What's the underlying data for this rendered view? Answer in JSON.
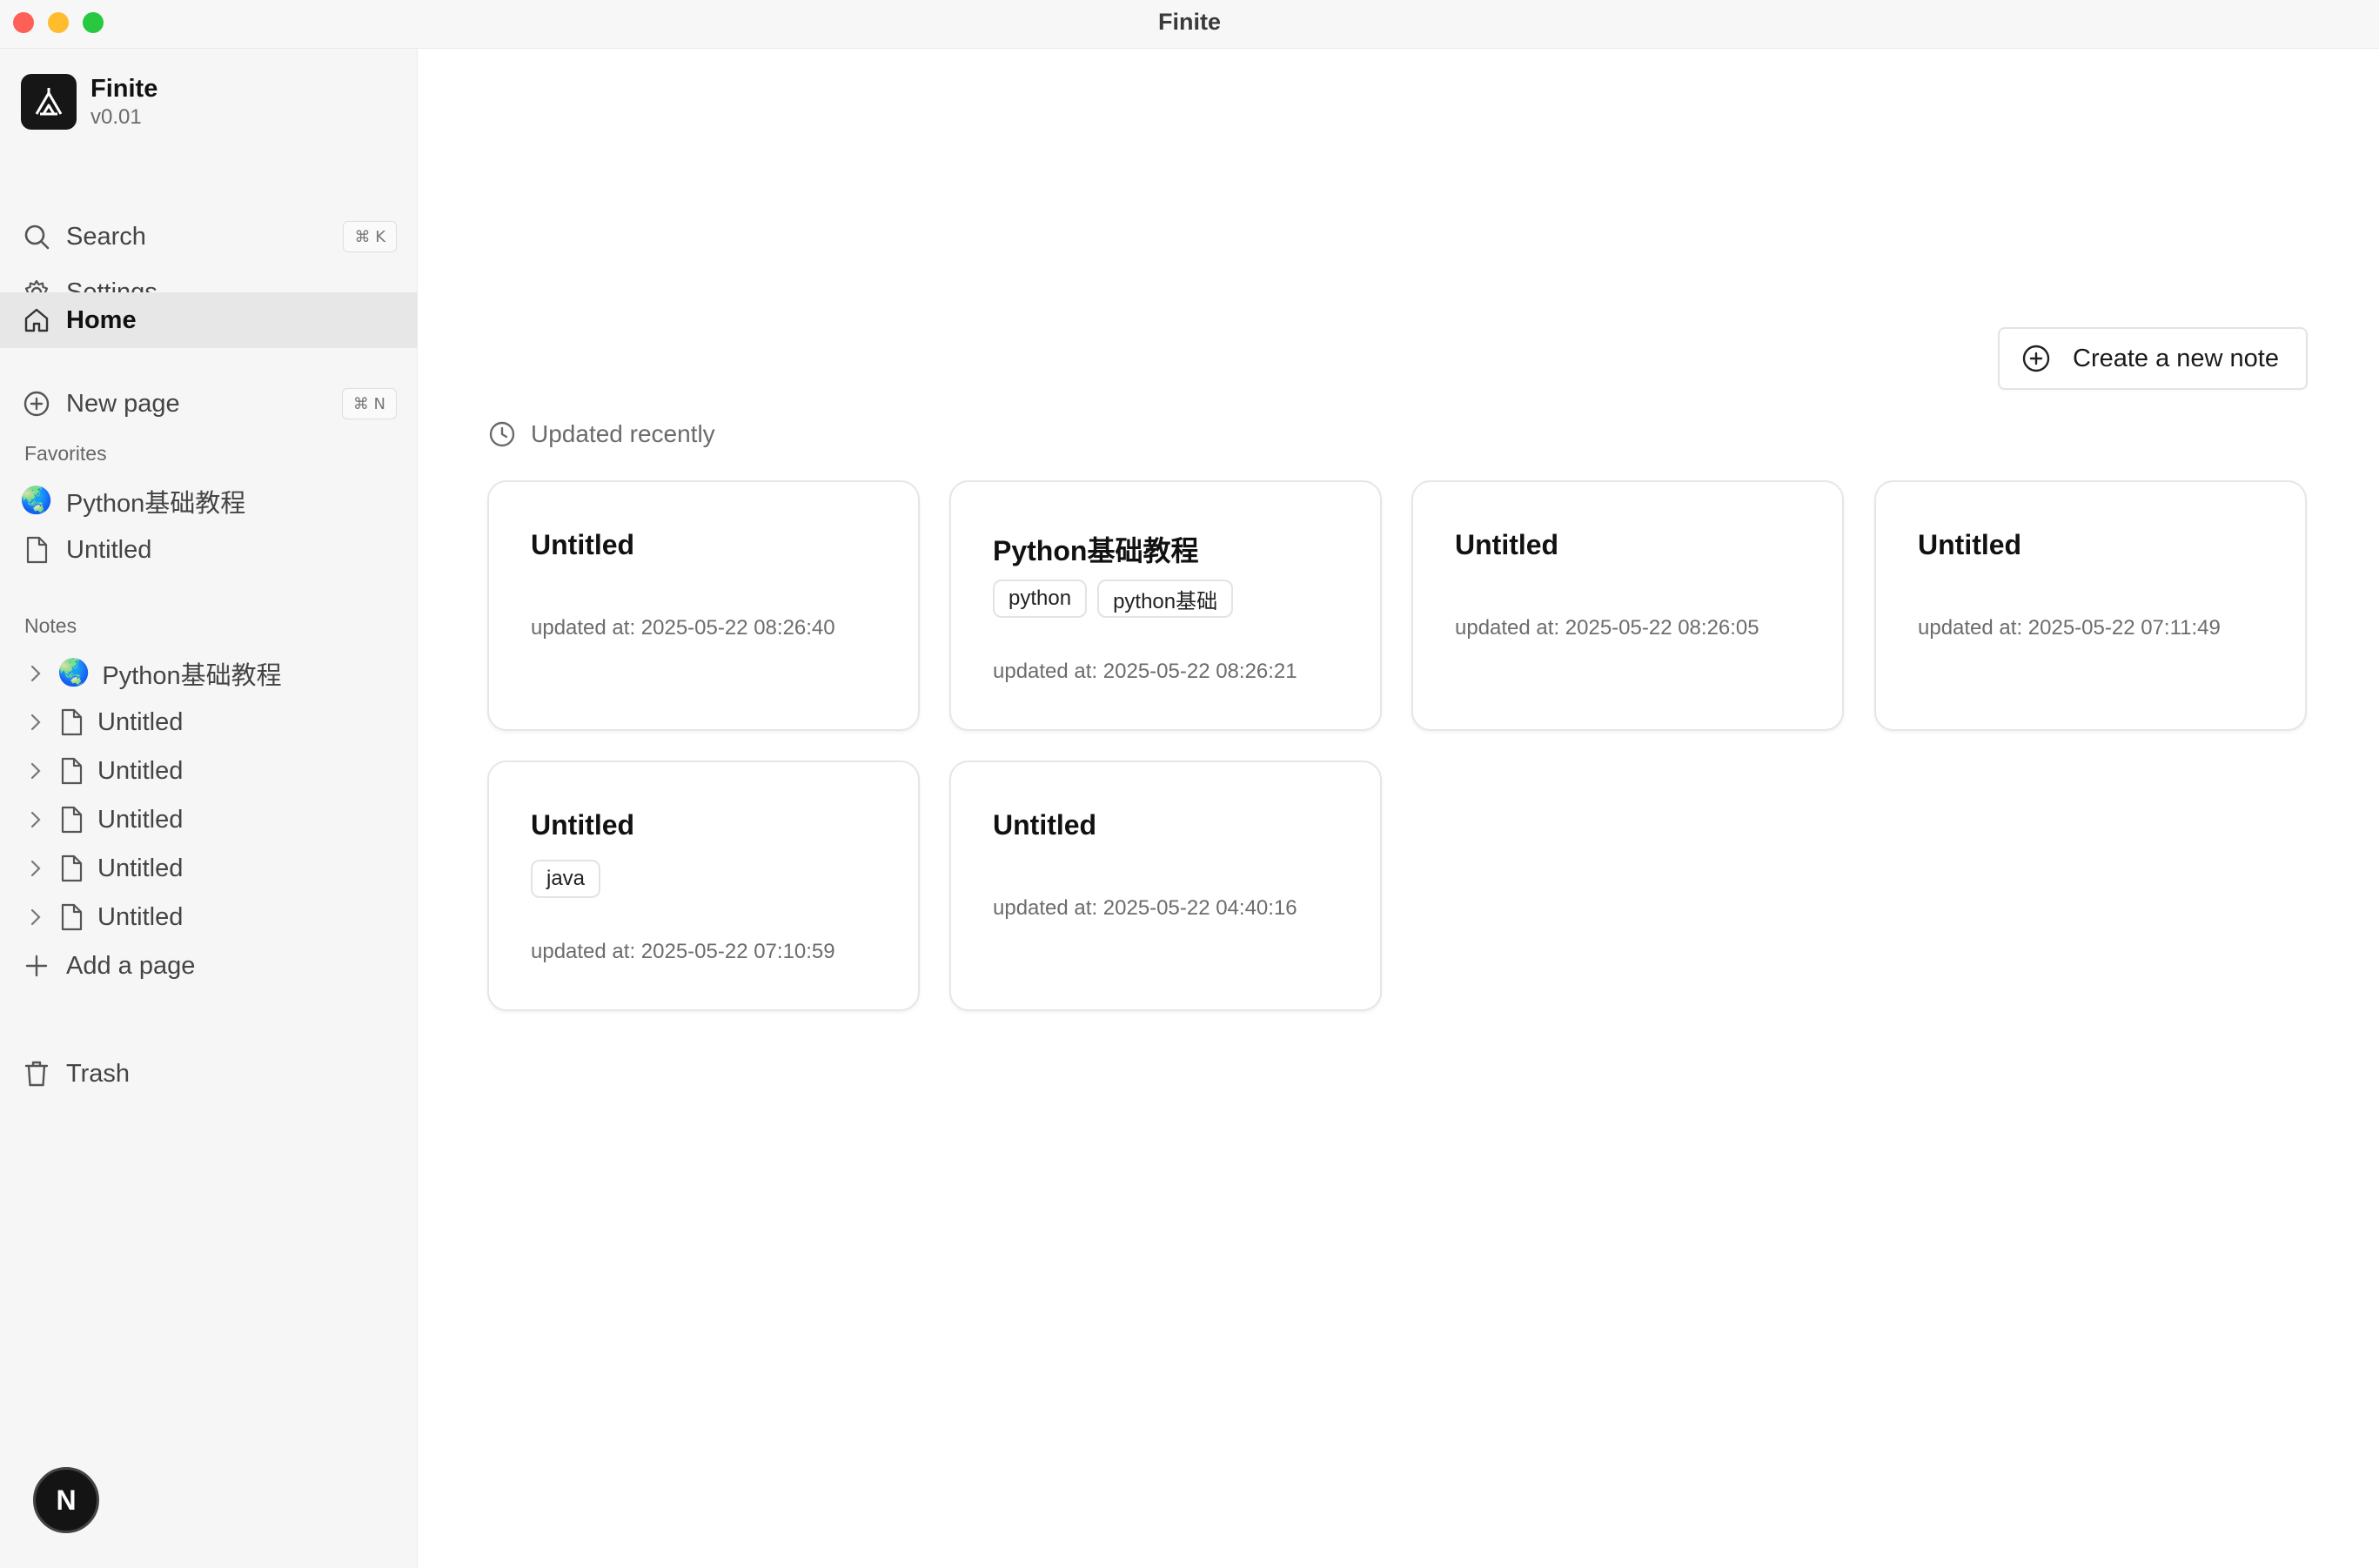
{
  "window": {
    "title": "Finite"
  },
  "brand": {
    "name": "Finite",
    "version": "v0.01"
  },
  "nav": {
    "search": {
      "label": "Search",
      "shortcut": "⌘ K"
    },
    "settings": {
      "label": "Settings"
    },
    "home": {
      "label": "Home"
    },
    "new_page": {
      "label": "New page",
      "shortcut": "⌘ N"
    }
  },
  "favorites": {
    "label": "Favorites",
    "items": [
      {
        "label": "Python基础教程",
        "icon": "globe-emoji"
      },
      {
        "label": "Untitled",
        "icon": "file-icon"
      }
    ]
  },
  "notes": {
    "label": "Notes",
    "items": [
      {
        "label": "Python基础教程",
        "icon": "globe-emoji"
      },
      {
        "label": "Untitled",
        "icon": "file-icon"
      },
      {
        "label": "Untitled",
        "icon": "file-icon"
      },
      {
        "label": "Untitled",
        "icon": "file-icon"
      },
      {
        "label": "Untitled",
        "icon": "file-icon"
      },
      {
        "label": "Untitled",
        "icon": "file-icon"
      }
    ],
    "add_label": "Add a page"
  },
  "trash": {
    "label": "Trash"
  },
  "avatar": {
    "letter": "N"
  },
  "main": {
    "create_button": "Create a new note",
    "recent_label": "Updated recently",
    "cards": [
      {
        "title": "Untitled",
        "tags": [],
        "updated": "updated at: 2025-05-22 08:26:40"
      },
      {
        "title": "Python基础教程",
        "tags": [
          "python",
          "python基础"
        ],
        "updated": "updated at: 2025-05-22 08:26:21"
      },
      {
        "title": "Untitled",
        "tags": [],
        "updated": "updated at: 2025-05-22 08:26:05"
      },
      {
        "title": "Untitled",
        "tags": [],
        "updated": "updated at: 2025-05-22 07:11:49"
      },
      {
        "title": "Untitled",
        "tags": [
          "java"
        ],
        "updated": "updated at: 2025-05-22 07:10:59"
      },
      {
        "title": "Untitled",
        "tags": [],
        "updated": "updated at: 2025-05-22 04:40:16"
      }
    ]
  },
  "colors": {
    "sidebar_bg": "#f6f6f6",
    "active_bg": "#e7e7e7",
    "accent_dark": "#161616"
  }
}
